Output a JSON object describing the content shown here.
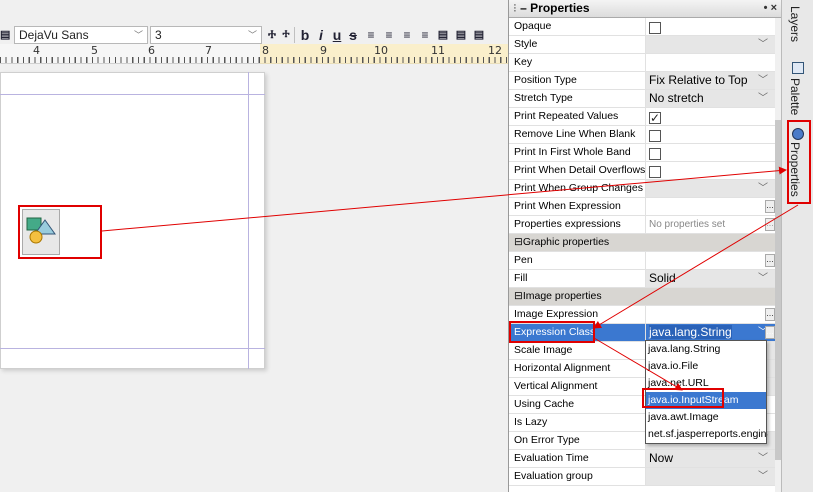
{
  "toolbar": {
    "font_name": "DejaVu Sans",
    "font_size": "3",
    "format_icons": [
      "increase-font-icon",
      "decrease-font-icon",
      "bold-icon",
      "italic-icon",
      "underline-icon",
      "strikethrough-icon",
      "align-left-icon",
      "align-center-icon",
      "align-right-icon",
      "justify-icon",
      "align-top-icon",
      "align-middle-icon",
      "align-bottom-icon"
    ]
  },
  "ruler": {
    "numbers": [
      "4",
      "5",
      "6",
      "7",
      "8",
      "9",
      "10",
      "11",
      "12"
    ]
  },
  "panel": {
    "title": "Properties",
    "controls": "• ×"
  },
  "properties": {
    "opaque": {
      "label": "Opaque",
      "checked": false
    },
    "style": {
      "label": "Style",
      "value": ""
    },
    "key": {
      "label": "Key",
      "value": ""
    },
    "position_type": {
      "label": "Position Type",
      "value": "Fix Relative to Top"
    },
    "stretch_type": {
      "label": "Stretch Type",
      "value": "No stretch"
    },
    "print_repeated": {
      "label": "Print Repeated Values",
      "checked": true
    },
    "remove_line": {
      "label": "Remove Line When Blank",
      "checked": false
    },
    "print_first_band": {
      "label": "Print In First Whole Band",
      "checked": false
    },
    "print_detail_overflows": {
      "label": "Print When Detail Overflows",
      "checked": false
    },
    "print_group_changes": {
      "label": "Print When Group Changes",
      "value": ""
    },
    "print_when_expr": {
      "label": "Print When Expression",
      "value": ""
    },
    "props_expressions": {
      "label": "Properties expressions",
      "value": "No properties set"
    },
    "graphic_section": {
      "label": "Graphic properties"
    },
    "pen": {
      "label": "Pen",
      "value": ""
    },
    "fill": {
      "label": "Fill",
      "value": "Solid"
    },
    "image_section": {
      "label": "Image properties"
    },
    "image_expression": {
      "label": "Image Expression",
      "value": ""
    },
    "expression_class": {
      "label": "Expression Class",
      "value": "java.lang.String"
    },
    "scale_image": {
      "label": "Scale Image"
    },
    "horizontal_alignment": {
      "label": "Horizontal Alignment"
    },
    "vertical_alignment": {
      "label": "Vertical Alignment"
    },
    "using_cache": {
      "label": "Using Cache"
    },
    "is_lazy": {
      "label": "Is Lazy"
    },
    "on_error_type": {
      "label": "On Error Type"
    },
    "evaluation_time": {
      "label": "Evaluation Time",
      "value": "Now"
    },
    "evaluation_group": {
      "label": "Evaluation group",
      "value": ""
    }
  },
  "dropdown": {
    "options": [
      "java.lang.String",
      "java.io.File",
      "java.net.URL",
      "java.io.InputStream",
      "java.awt.Image",
      "net.sf.jasperreports.engine.JR"
    ],
    "highlighted_index": 3
  },
  "side_tabs": {
    "layers": "Layers",
    "palette": "Palette",
    "properties": "Properties"
  },
  "colors": {
    "highlight": "#e00000",
    "selection": "#3b78d0"
  }
}
